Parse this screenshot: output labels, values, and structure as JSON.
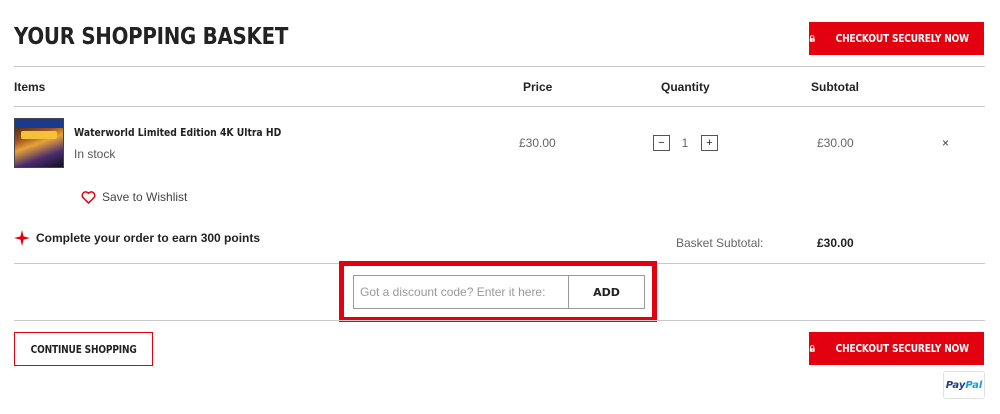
{
  "header": {
    "title": "YOUR SHOPPING BASKET",
    "checkout_label": "CHECKOUT SECURELY NOW"
  },
  "table": {
    "headers": [
      "Items",
      "Price",
      "Quantity",
      "Subtotal"
    ]
  },
  "item": {
    "name": "Waterworld Limited Edition 4K Ultra HD",
    "stock": "In stock",
    "price": "£30.00",
    "quantity": "1",
    "qty_minus": "−",
    "qty_plus": "+",
    "subtotal": "£30.00",
    "remove": "×",
    "wishlist_label": "Save to Wishlist"
  },
  "points": {
    "text": "Complete your order to earn 300 points"
  },
  "summary": {
    "label": "Basket Subtotal:",
    "value": "£30.00"
  },
  "discount": {
    "placeholder": "Got a discount code? Enter it here:",
    "value": "",
    "add_label": "ADD"
  },
  "footer": {
    "continue_label": "CONTINUE SHOPPING",
    "checkout_label": "CHECKOUT SECURELY NOW",
    "paypal_pay": "Pay",
    "paypal_pal": "Pal"
  },
  "colors": {
    "accent": "#e3000f",
    "divider": "#c9c9c9",
    "text": "#222222",
    "muted": "#666666"
  },
  "icons": {
    "lock": "lock-icon",
    "heart": "heart-icon",
    "star": "star-icon",
    "remove": "close-icon"
  }
}
